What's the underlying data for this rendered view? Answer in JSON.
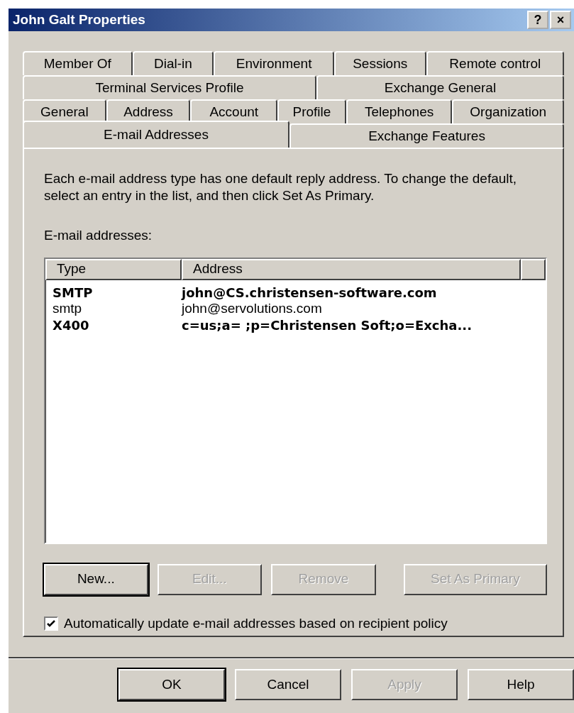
{
  "window": {
    "title": "John Galt Properties",
    "title_buttons": [
      "?",
      "×"
    ]
  },
  "tab_rows": [
    [
      {
        "label": "Member Of",
        "selected": false
      },
      {
        "label": "Dial-in",
        "selected": false
      },
      {
        "label": "Environment",
        "selected": false
      },
      {
        "label": "Sessions",
        "selected": false
      },
      {
        "label": "Remote control",
        "selected": false
      }
    ],
    [
      {
        "label": "Terminal Services Profile",
        "selected": false
      },
      {
        "label": "Exchange General",
        "selected": false
      }
    ],
    [
      {
        "label": "General",
        "selected": false
      },
      {
        "label": "Address",
        "selected": false
      },
      {
        "label": "Account",
        "selected": false
      },
      {
        "label": "Profile",
        "selected": false
      },
      {
        "label": "Telephones",
        "selected": false
      },
      {
        "label": "Organization",
        "selected": false
      }
    ],
    [
      {
        "label": "E-mail Addresses",
        "selected": true
      },
      {
        "label": "Exchange Features",
        "selected": false
      }
    ]
  ],
  "description": "Each e-mail address type has one default reply address. To change the default, select an entry in the list, and then click Set As Primary.",
  "list_label": "E-mail addresses:",
  "table": {
    "columns": [
      "Type",
      "Address"
    ],
    "rows": [
      {
        "type": "SMTP",
        "address": "john@CS.christensen-software.com",
        "primary": true
      },
      {
        "type": "smtp",
        "address": "john@servolutions.com",
        "primary": false
      },
      {
        "type": "X400",
        "address": "c=us;a= ;p=Christensen Soft;o=Excha...",
        "primary": true
      }
    ]
  },
  "list_buttons": [
    {
      "label": "New...",
      "disabled": false,
      "default": true
    },
    {
      "label": "Edit...",
      "disabled": true,
      "default": false
    },
    {
      "label": "Remove",
      "disabled": true,
      "default": false
    },
    {
      "label": "Set As Primary",
      "disabled": true,
      "default": false
    }
  ],
  "auto_update": {
    "label": "Automatically update e-mail addresses based on recipient policy",
    "checked": true
  },
  "dialog_buttons": [
    {
      "label": "OK",
      "disabled": false,
      "default": true
    },
    {
      "label": "Cancel",
      "disabled": false,
      "default": false
    },
    {
      "label": "Apply",
      "disabled": true,
      "default": false
    },
    {
      "label": "Help",
      "disabled": false,
      "default": false
    }
  ]
}
